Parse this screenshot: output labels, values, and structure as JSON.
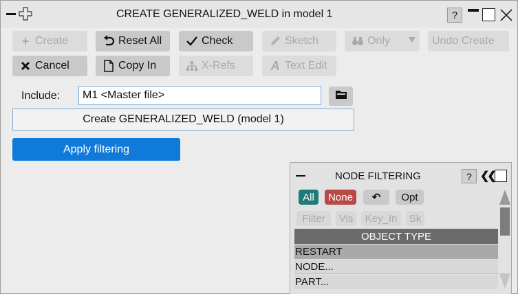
{
  "window": {
    "title": "CREATE GENERALIZED_WELD in model 1",
    "help_label": "?"
  },
  "toolbar": {
    "create": "Create",
    "reset_all": "Reset All",
    "check": "Check",
    "sketch": "Sketch",
    "only": "Only",
    "undo_create": "Undo Create",
    "cancel": "Cancel",
    "copy_in": "Copy In",
    "x_refs": "X-Refs",
    "text_edit": "Text Edit"
  },
  "include": {
    "label": "Include:",
    "value": "M1  <Master file>"
  },
  "create_field": {
    "value": "Create GENERALIZED_WELD (model 1)"
  },
  "apply_filtering": "Apply filtering",
  "node_filtering": {
    "title": "NODE FILTERING",
    "help_label": "?",
    "collapse_label": "❮❮",
    "chips": {
      "all": "All",
      "none": "None",
      "swap": "↶",
      "opt": "Opt",
      "filter": "Filter",
      "vis": "Vis",
      "key_in": "Key_In",
      "sk": "Sk"
    },
    "header": "OBJECT TYPE",
    "items": [
      "RESTART",
      "NODE...",
      "PART..."
    ]
  },
  "colors": {
    "primary": "#0f7ad9",
    "chip_all": "#1f7a7a",
    "chip_none": "#b94a47",
    "header_bg": "#6b6b6b"
  },
  "icons": {
    "minimize": "minimize-icon",
    "move": "move-cross-icon",
    "maximize": "maximize-icon",
    "close": "close-icon"
  }
}
